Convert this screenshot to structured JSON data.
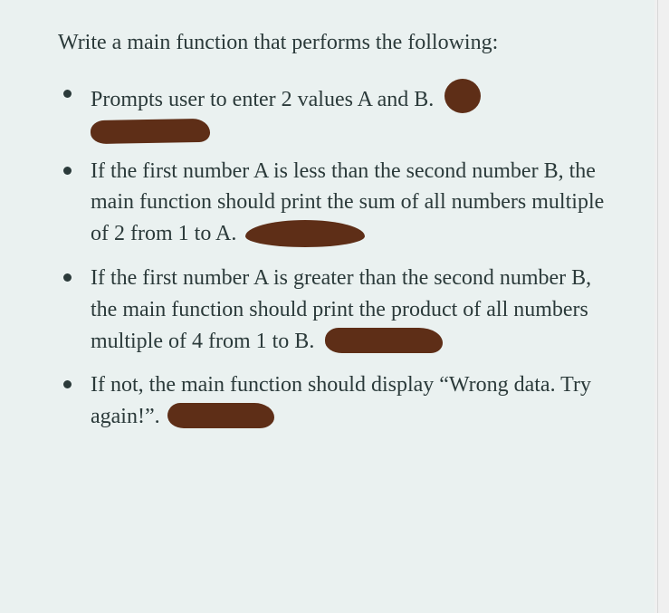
{
  "intro": "Write a main function that performs the following:",
  "bullets": [
    {
      "text": "Prompts user to enter 2 values A and B.",
      "redaction_after_inline": "dot1",
      "redaction_below": "stroke-below"
    },
    {
      "text": "If the first number A is less than the second number B, the main function should print the sum of all numbers multiple of 2 from 1 to A.",
      "redaction_after_inline": "stroke2"
    },
    {
      "text": "If the first number A is greater than the second number B, the main function should print the product of all numbers multiple of 4 from 1 to B.",
      "redaction_after_inline": "stroke3"
    },
    {
      "text": "If not, the main function should display “Wrong data. Try again!”.",
      "redaction_after_inline": "stroke4"
    }
  ]
}
